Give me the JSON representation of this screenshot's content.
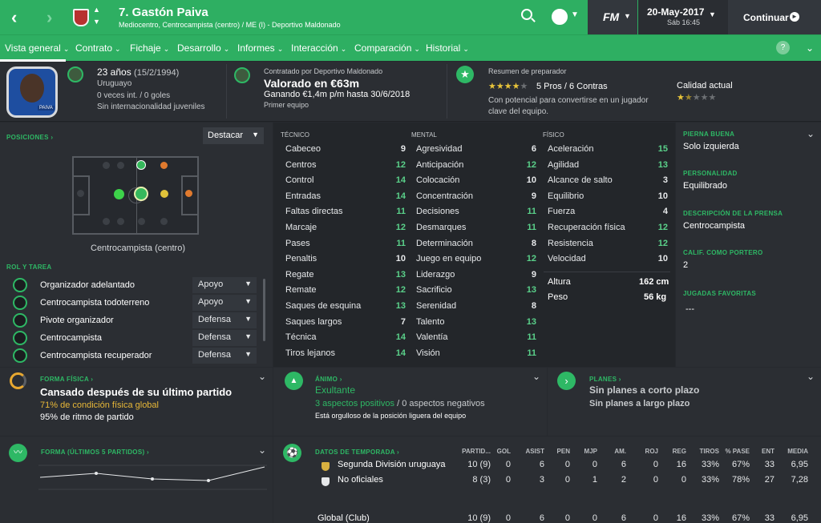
{
  "header": {
    "player_title": "7. Gastón Paiva",
    "player_subtitle": "Mediocentro, Centrocampista (centro) / ME (I) - Deportivo Maldonado",
    "date": "20-May-2017",
    "time": "Sáb 16:45",
    "continue_label": "Continuar",
    "fm_logo": "FM"
  },
  "nav": {
    "tabs": [
      "Vista general",
      "Contrato",
      "Fichaje",
      "Desarrollo",
      "Informes",
      "Interacción",
      "Comparación",
      "Historial"
    ],
    "help": "?"
  },
  "bio": {
    "age": "23 años",
    "dob": "(15/2/1994)",
    "nation": "Uruguayo",
    "caps": "0 veces int. / 0 goles",
    "youth": "Sin internacionalidad juveniles",
    "photo_tag": "PAIVA"
  },
  "contract": {
    "label": "Contratado por Deportivo Maldonado",
    "value": "Valorado en €63m",
    "wage": "Ganando €1,4m p/m hasta 30/6/2018",
    "squad": "Primer equipo"
  },
  "coach": {
    "label": "Resumen de preparador",
    "pros": "5 Pros / 6 Contras",
    "text1": "Con potencial para convertirse en un jugador",
    "text2": "clave del equipo.",
    "ability_label": "Calidad actual",
    "pros_stars": 4,
    "ability_stars": 1.5
  },
  "positions": {
    "label": "POSICIONES",
    "highlight": "Destacar",
    "position_name": "Centrocampista (centro)"
  },
  "roles": {
    "label": "ROL Y TAREA",
    "items": [
      {
        "name": "Organizador adelantado",
        "duty": "Apoyo"
      },
      {
        "name": "Centrocampista todoterreno",
        "duty": "Apoyo"
      },
      {
        "name": "Pivote organizador",
        "duty": "Defensa"
      },
      {
        "name": "Centrocampista",
        "duty": "Defensa"
      },
      {
        "name": "Centrocampista recuperador",
        "duty": "Defensa"
      }
    ]
  },
  "attributes": {
    "technical_label": "TÉCNICO",
    "mental_label": "MENTAL",
    "physical_label": "FÍSICO",
    "technical": [
      [
        "Cabeceo",
        "9"
      ],
      [
        "Centros",
        "12"
      ],
      [
        "Control",
        "14"
      ],
      [
        "Entradas",
        "14"
      ],
      [
        "Faltas directas",
        "11"
      ],
      [
        "Marcaje",
        "12"
      ],
      [
        "Pases",
        "11"
      ],
      [
        "Penaltis",
        "10"
      ],
      [
        "Regate",
        "13"
      ],
      [
        "Remate",
        "12"
      ],
      [
        "Saques de esquina",
        "13"
      ],
      [
        "Saques largos",
        "7"
      ],
      [
        "Técnica",
        "14"
      ],
      [
        "Tiros lejanos",
        "14"
      ]
    ],
    "mental": [
      [
        "Agresividad",
        "6"
      ],
      [
        "Anticipación",
        "12"
      ],
      [
        "Colocación",
        "10"
      ],
      [
        "Concentración",
        "9"
      ],
      [
        "Decisiones",
        "11"
      ],
      [
        "Desmarques",
        "11"
      ],
      [
        "Determinación",
        "8"
      ],
      [
        "Juego en equipo",
        "12"
      ],
      [
        "Liderazgo",
        "9"
      ],
      [
        "Sacrificio",
        "13"
      ],
      [
        "Serenidad",
        "8"
      ],
      [
        "Talento",
        "13"
      ],
      [
        "Valentía",
        "11"
      ],
      [
        "Visión",
        "11"
      ]
    ],
    "physical": [
      [
        "Aceleración",
        "15"
      ],
      [
        "Agilidad",
        "13"
      ],
      [
        "Alcance de salto",
        "3"
      ],
      [
        "Equilibrio",
        "10"
      ],
      [
        "Fuerza",
        "4"
      ],
      [
        "Recuperación física",
        "12"
      ],
      [
        "Resistencia",
        "12"
      ],
      [
        "Velocidad",
        "10"
      ]
    ],
    "height_label": "Altura",
    "height": "162 cm",
    "weight_label": "Peso",
    "weight": "56 kg"
  },
  "side": {
    "foot_label": "PIERNA BUENA",
    "foot": "Solo izquierda",
    "personality_label": "PERSONALIDAD",
    "personality": "Equilibrado",
    "press_label": "DESCRIPCIÓN DE LA PRENSA",
    "press": "Centrocampista",
    "gk_label": "CALIF. COMO PORTERO",
    "gk": "2",
    "moves_label": "JUGADAS FAVORITAS",
    "moves": "---"
  },
  "fitness": {
    "label": "FORMA FÍSICA",
    "title": "Cansado después de su último partido",
    "condition": "71% de condición física global",
    "match": "95% de ritmo de partido"
  },
  "morale": {
    "label": "ÁNIMO",
    "status": "Exultante",
    "positive": "3 aspectos positivos",
    "negative": "0 aspectos negativos",
    "note": "Está orgulloso de la posición liguera del equipo"
  },
  "plans": {
    "label": "PLANES",
    "short": "Sin planes a corto plazo",
    "long": "Sin planes a largo plazo"
  },
  "form": {
    "label": "FORMA (ÚLTIMOS 5 PARTIDOS)"
  },
  "season": {
    "label": "DATOS DE TEMPORADA",
    "headers": [
      "PARTID...",
      "GOL",
      "ASIST",
      "PEN",
      "MJP",
      "AM.",
      "ROJ",
      "REG",
      "TIROS",
      "% PASE",
      "ENT",
      "MEDIA"
    ],
    "rows": [
      {
        "comp": "Segunda División uruguaya",
        "vals": [
          "10 (9)",
          "0",
          "6",
          "0",
          "0",
          "6",
          "0",
          "16",
          "33%",
          "67%",
          "33",
          "6,95"
        ]
      },
      {
        "comp": "No oficiales",
        "vals": [
          "8 (3)",
          "0",
          "3",
          "0",
          "1",
          "2",
          "0",
          "0",
          "33%",
          "78%",
          "27",
          "7,28"
        ]
      },
      {
        "comp": "Global (Club)",
        "vals": [
          "10 (9)",
          "0",
          "6",
          "0",
          "0",
          "6",
          "0",
          "16",
          "33%",
          "67%",
          "33",
          "6,95"
        ]
      }
    ]
  },
  "colors": {
    "accent": "#2eaf62",
    "bg": "#26292e",
    "high": "#5ad18a"
  }
}
